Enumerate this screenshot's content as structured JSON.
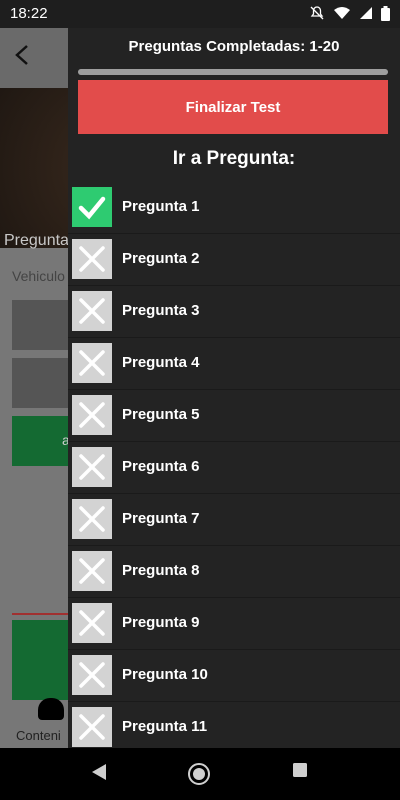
{
  "status_bar": {
    "time": "18:22"
  },
  "background_app": {
    "hero_caption": "Pregunta",
    "subtitle": "Vehiculo",
    "bottom_label": "Conteni",
    "green_option_partial": "a"
  },
  "drawer": {
    "completed_label": "Preguntas Completadas: 1-20",
    "progress": 1.0,
    "finish_button": "Finalizar Test",
    "goto_title": "Ir a Pregunta:",
    "questions": [
      {
        "label": "Pregunta 1",
        "status": "answered"
      },
      {
        "label": "Pregunta 2",
        "status": "unanswered"
      },
      {
        "label": "Pregunta 3",
        "status": "unanswered"
      },
      {
        "label": "Pregunta 4",
        "status": "unanswered"
      },
      {
        "label": "Pregunta 5",
        "status": "unanswered"
      },
      {
        "label": "Pregunta 6",
        "status": "unanswered"
      },
      {
        "label": "Pregunta 7",
        "status": "unanswered"
      },
      {
        "label": "Pregunta 8",
        "status": "unanswered"
      },
      {
        "label": "Pregunta 9",
        "status": "unanswered"
      },
      {
        "label": "Pregunta 10",
        "status": "unanswered"
      },
      {
        "label": "Pregunta 11",
        "status": "unanswered"
      }
    ]
  },
  "colors": {
    "finish": "#e24c4b",
    "answered": "#2ecb71",
    "unanswered": "#d3d3d3",
    "drawer_bg": "#232323"
  }
}
